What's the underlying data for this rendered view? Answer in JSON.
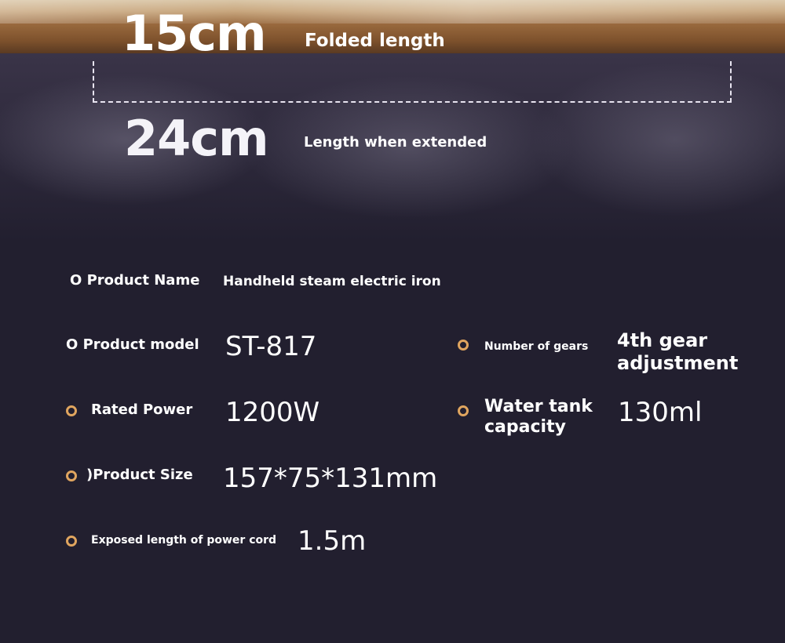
{
  "header": {
    "folded_value": "15cm",
    "folded_label": "Folded length",
    "extended_value": "24cm",
    "extended_label": "Length when extended"
  },
  "specs": {
    "product_name_label": "O Product Name",
    "product_name_value": "Handheld steam electric iron",
    "product_model_label": "O Product model",
    "product_model_value": "ST-817",
    "gears_label": "Number of gears",
    "gears_value_line1": "4th gear",
    "gears_value_line2": "adjustment",
    "rated_power_label": "Rated Power",
    "rated_power_value": "1200W",
    "water_tank_label_line1": "Water tank",
    "water_tank_label_line2": "capacity",
    "water_tank_value": "130ml",
    "product_size_label": ")Product Size",
    "product_size_value": "157*75*131mm",
    "cord_label": "Exposed length of power cord",
    "cord_value": "1.5m"
  },
  "colors": {
    "background": "#221f2f",
    "accent_ring": "#e0a55f",
    "text": "#ffffff"
  },
  "icons": {
    "bullet": "orange-ring-icon"
  }
}
